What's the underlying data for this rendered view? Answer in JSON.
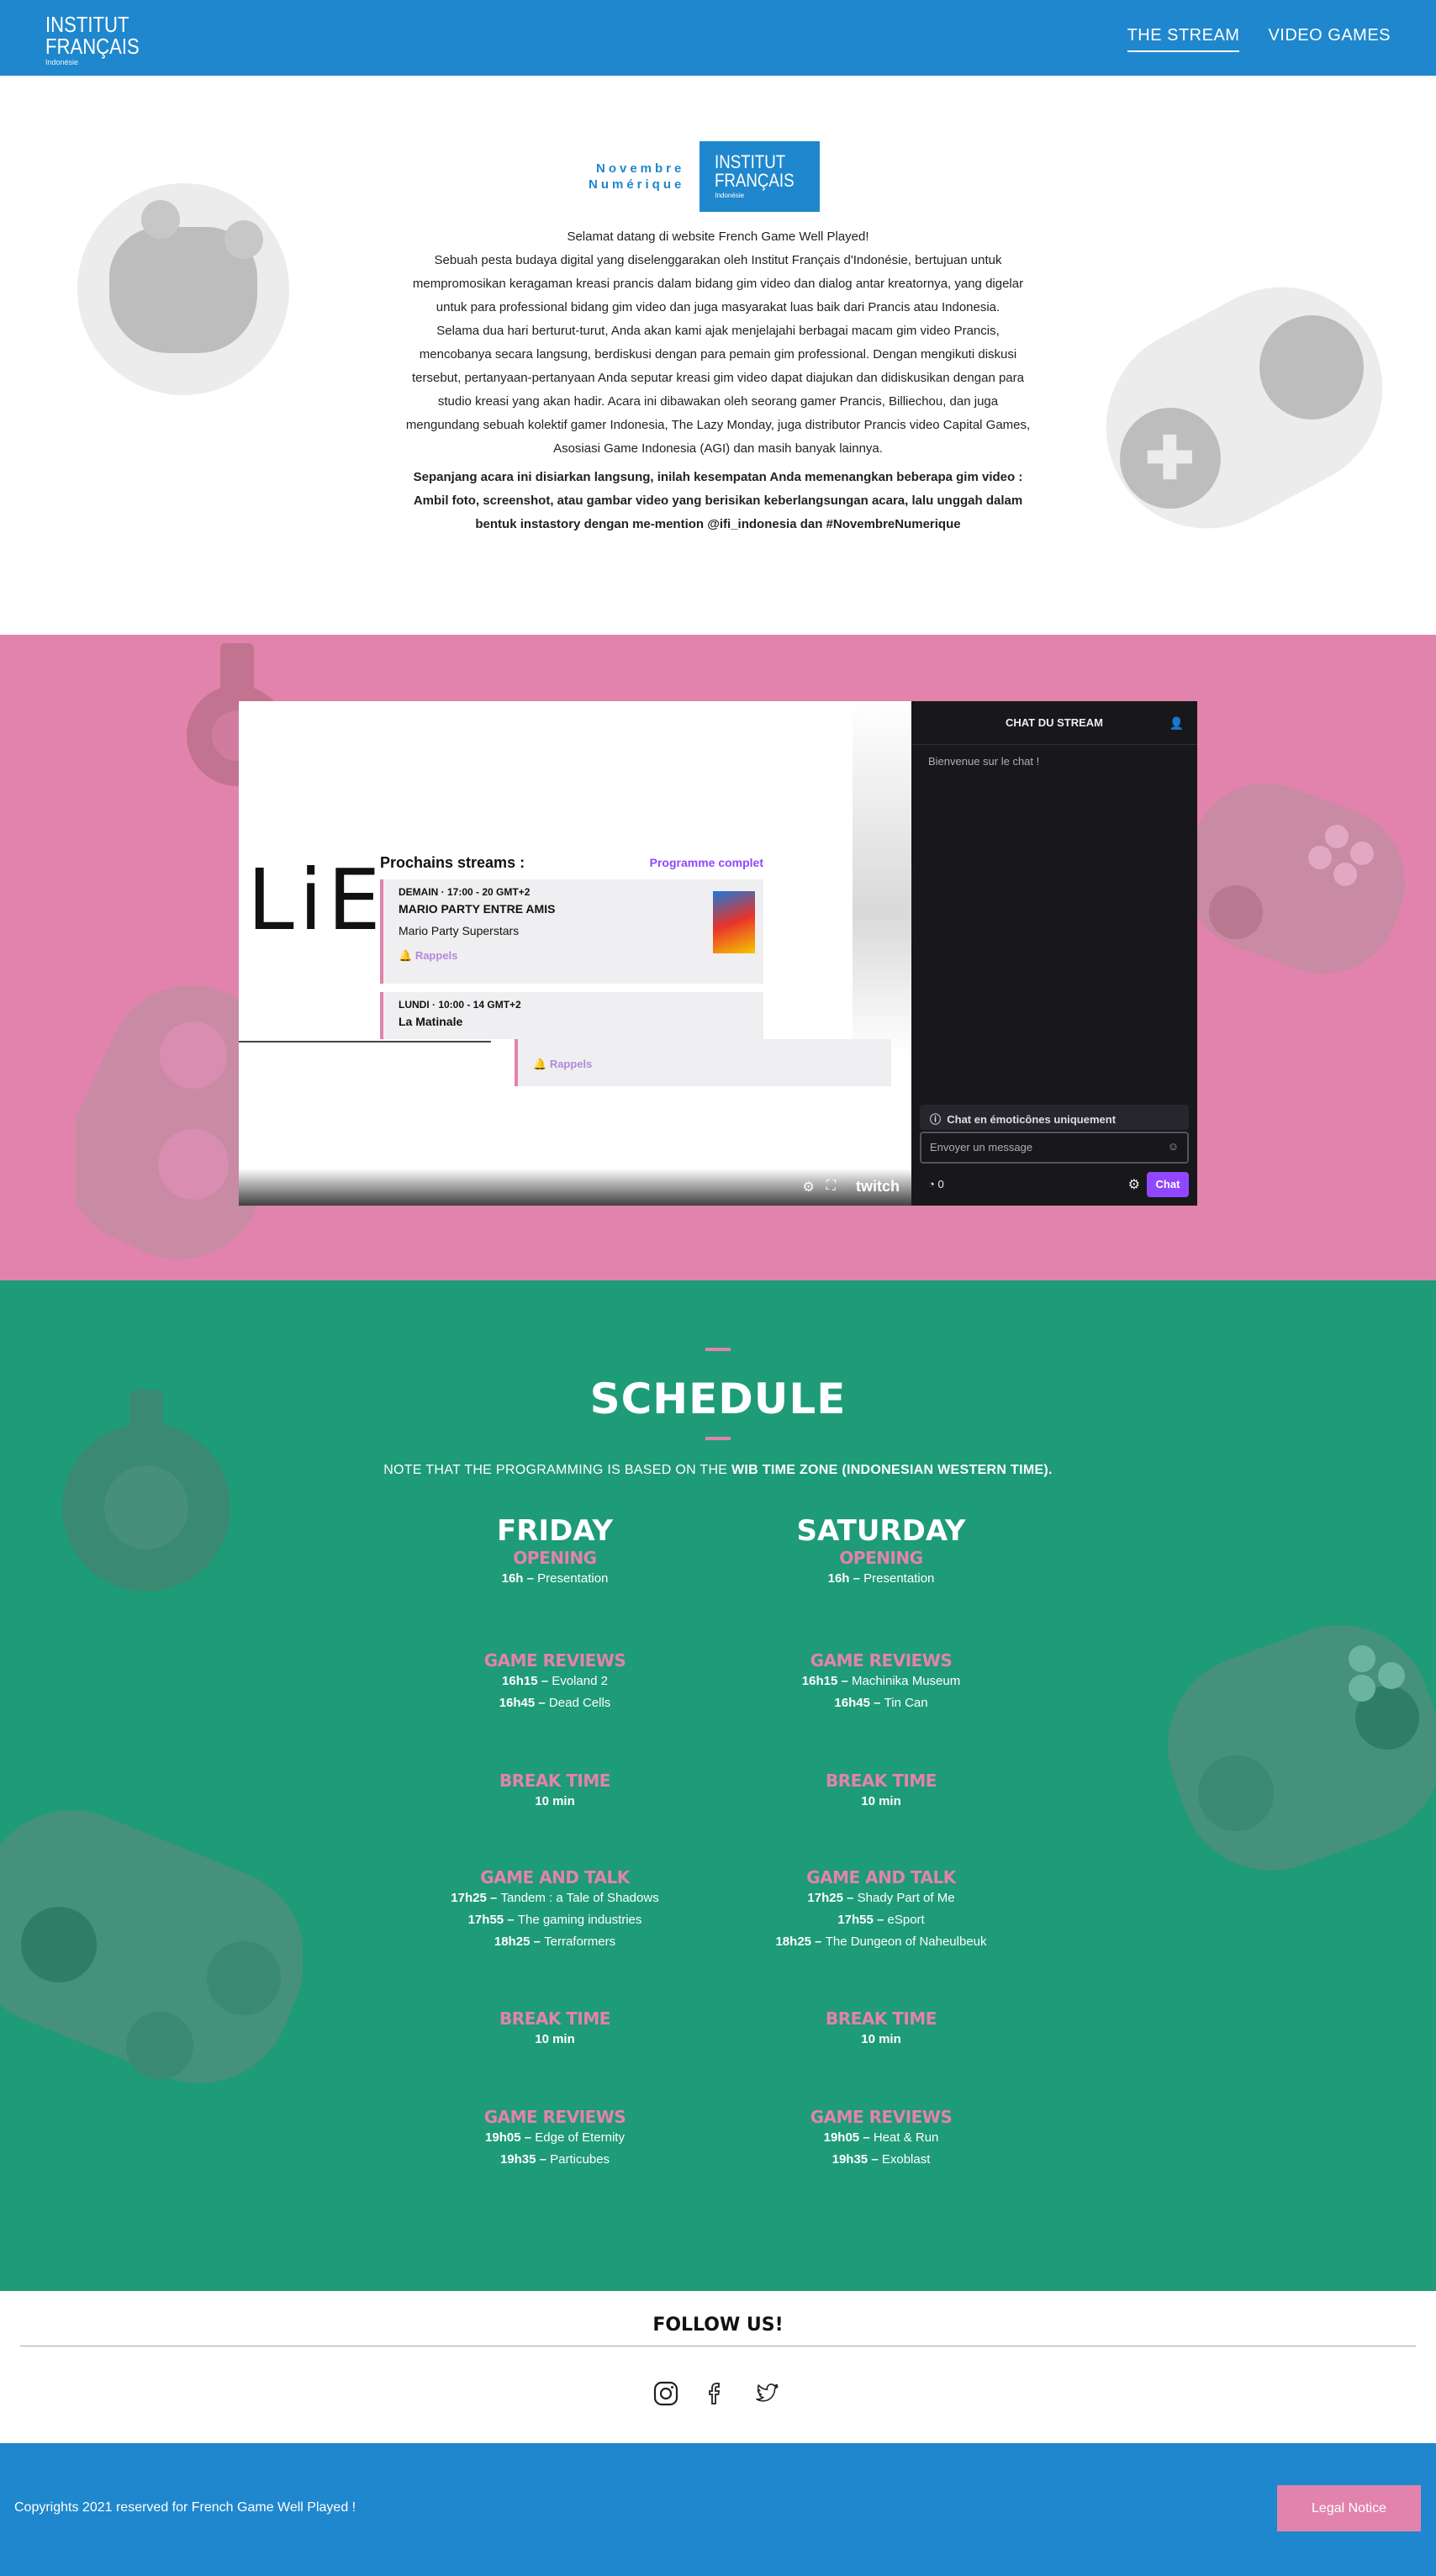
{
  "header": {
    "logo_line1": "INSTITUT",
    "logo_line2": "FRANÇAIS",
    "logo_line3": "Indonésie",
    "nav": [
      "THE STREAM",
      "VIDEO GAMES"
    ]
  },
  "intro": {
    "brand_line1": "Novembre",
    "brand_line2": "Numérique",
    "box_line1": "INSTITUT",
    "box_line2": "FRANÇAIS",
    "box_line3": "Indonésie",
    "p1": "Selamat datang di website French Game Well Played!",
    "p2": "Sebuah pesta budaya digital yang diselenggarakan oleh Institut Français d'Indonésie, bertujuan untuk mempromosikan keragaman kreasi prancis dalam bidang gim video dan dialog antar kreatornya, yang digelar untuk para professional bidang gim video dan juga masyarakat luas baik dari Prancis atau Indonesia.",
    "p3": "Selama dua hari berturut-turut, Anda akan kami ajak menjelajahi berbagai macam gim video Prancis, mencobanya secara langsung, berdiskusi dengan para pemain gim professional. Dengan mengikuti diskusi tersebut, pertanyaan-pertanyaan Anda seputar kreasi gim video dapat diajukan dan didiskusikan dengan para studio kreasi yang akan hadir. Acara ini dibawakan oleh seorang gamer Prancis, Billiechou, dan juga mengundang sebuah kolektif gamer Indonesia, The Lazy Monday, juga distributor Prancis video Capital Games, Asosiasi Game Indonesia (AGI) dan masih banyak lainnya.",
    "p4": "Sepanjang acara ini disiarkan langsung, inilah kesempatan Anda memenangkan beberapa gim video : Ambil foto, screenshot, atau gambar video yang berisikan keberlangsungan acara, lalu unggah dalam bentuk instastory dengan me-mention @ifi_indonesia dan #NovembreNumerique"
  },
  "stream": {
    "player_text": "LiE",
    "twitch": "twitch",
    "upcoming_title": "Prochains streams :",
    "upcoming_link": "Programme complet",
    "cards": [
      {
        "meta": "DEMAIN · 17:00 - 20 GMT+2",
        "title": "MARIO PARTY ENTRE AMIS",
        "game": "Mario Party Superstars",
        "remind": "Rappels"
      },
      {
        "meta": "LUNDI · 10:00 - 14 GMT+2",
        "title": "La Matinale",
        "remind": "Rappels"
      }
    ],
    "chat": {
      "title": "CHAT DU STREAM",
      "welcome": "Bienvenue sur le chat !",
      "emote_only": "Chat en émoticônes uniquement",
      "placeholder": "Envoyer un message",
      "points": "0",
      "send": "Chat"
    }
  },
  "schedule": {
    "title": "SCHEDULE",
    "note_prefix": "NOTE THAT THE PROGRAMMING IS BASED ON THE ",
    "note_bold": "WIB TIME ZONE (INDONESIAN WESTERN TIME).",
    "friday": {
      "name": "FRIDAY",
      "blocks": [
        {
          "title": "OPENING",
          "rows": [
            [
              "16h",
              "Presentation"
            ]
          ]
        },
        {
          "title": "GAME REVIEWS",
          "rows": [
            [
              "16h15",
              "Evoland 2"
            ],
            [
              "16h45",
              "Dead Cells"
            ]
          ]
        },
        {
          "title": "BREAK TIME",
          "rows": [
            [
              "10 min",
              ""
            ]
          ]
        },
        {
          "title": "GAME AND TALK",
          "rows": [
            [
              "17h25",
              "Tandem : a Tale of Shadows"
            ],
            [
              "17h55",
              "The gaming industries"
            ],
            [
              "18h25",
              "Terraformers"
            ]
          ]
        },
        {
          "title": "BREAK TIME",
          "rows": [
            [
              "10 min",
              ""
            ]
          ]
        },
        {
          "title": "GAME REVIEWS",
          "rows": [
            [
              "19h05",
              "Edge of Eternity"
            ],
            [
              "19h35",
              "Particubes"
            ]
          ]
        }
      ]
    },
    "saturday": {
      "name": "SATURDAY",
      "blocks": [
        {
          "title": "OPENING",
          "rows": [
            [
              "16h",
              "Presentation"
            ]
          ]
        },
        {
          "title": "GAME REVIEWS",
          "rows": [
            [
              "16h15",
              "Machinika Museum"
            ],
            [
              "16h45",
              "Tin Can"
            ]
          ]
        },
        {
          "title": "BREAK TIME",
          "rows": [
            [
              "10 min",
              ""
            ]
          ]
        },
        {
          "title": "GAME AND TALK",
          "rows": [
            [
              "17h25",
              "Shady Part of Me"
            ],
            [
              "17h55",
              "eSport"
            ],
            [
              "18h25",
              "The Dungeon of Naheulbeuk"
            ]
          ]
        },
        {
          "title": "BREAK TIME",
          "rows": [
            [
              "10 min",
              ""
            ]
          ]
        },
        {
          "title": "GAME REVIEWS",
          "rows": [
            [
              "19h05",
              "Heat & Run"
            ],
            [
              "19h35",
              "Exoblast"
            ]
          ]
        }
      ]
    }
  },
  "follow": {
    "title": "FOLLOW US!",
    "icons": [
      "instagram-icon",
      "facebook-icon",
      "twitter-icon"
    ]
  },
  "footer": {
    "copyright": "Copyrights 2021 reserved for French Game Well Played !",
    "legal": "Legal Notice"
  },
  "colors": {
    "blue": "#1f87cd",
    "pink": "#e283ad",
    "green": "#1e9b77",
    "twitch_purple": "#9147ff"
  }
}
